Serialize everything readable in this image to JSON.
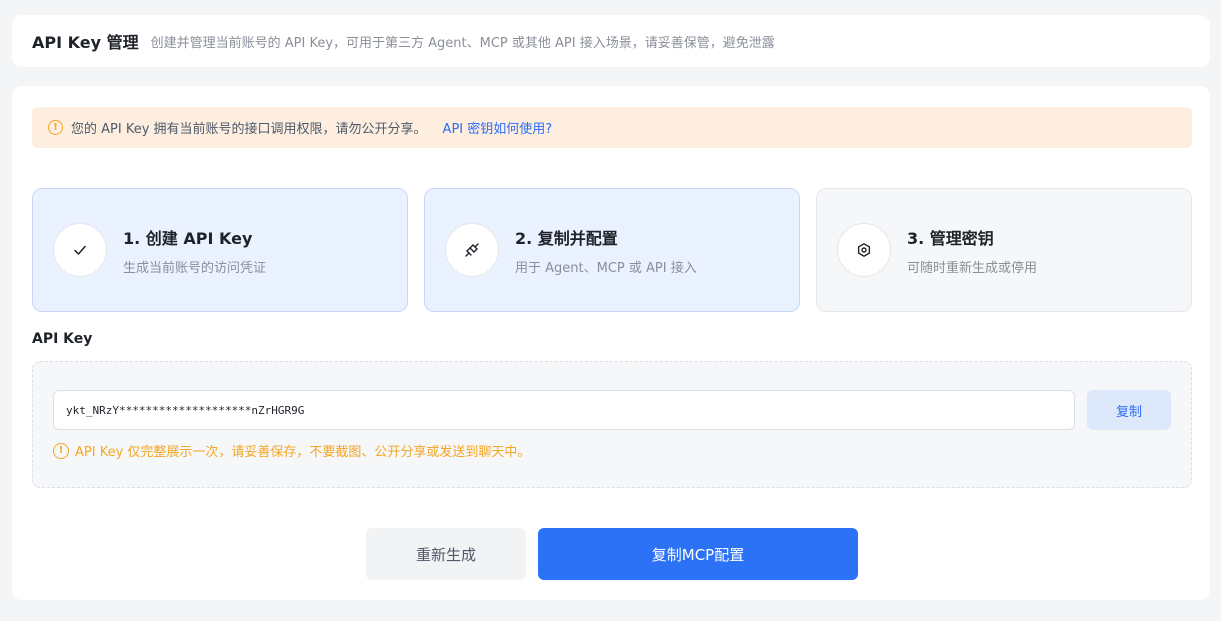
{
  "header": {
    "title": "API Key 管理",
    "subtitle": "创建并管理当前账号的 API Key，可用于第三方 Agent、MCP 或其他 API 接入场景，请妥善保管，避免泄露"
  },
  "notice": {
    "text": "您的 API Key 拥有当前账号的接口调用权限，请勿公开分享。",
    "link": "API 密钥如何使用?"
  },
  "steps": [
    {
      "title": "1. 创建 API Key",
      "desc": "生成当前账号的访问凭证",
      "icon": "check-icon"
    },
    {
      "title": "2. 复制并配置",
      "desc": "用于 Agent、MCP 或 API 接入",
      "icon": "plug-icon"
    },
    {
      "title": "3. 管理密钥",
      "desc": "可随时重新生成或停用",
      "icon": "hexagon-settings-icon"
    }
  ],
  "api_key": {
    "label": "API Key",
    "value": "ykt_NRzY********************nZrHGR9G",
    "copy_label": "复制",
    "warning": "API Key 仅完整展示一次，请妥善保存，不要截图、公开分享或发送到聊天中。"
  },
  "actions": {
    "regenerate_label": "重新生成",
    "copy_mcp_label": "复制MCP配置"
  },
  "colors": {
    "primary": "#2b72f7",
    "warning": "#f5a623",
    "notice_bg": "#fdeee0",
    "active_step_bg": "#ebf2ff"
  }
}
